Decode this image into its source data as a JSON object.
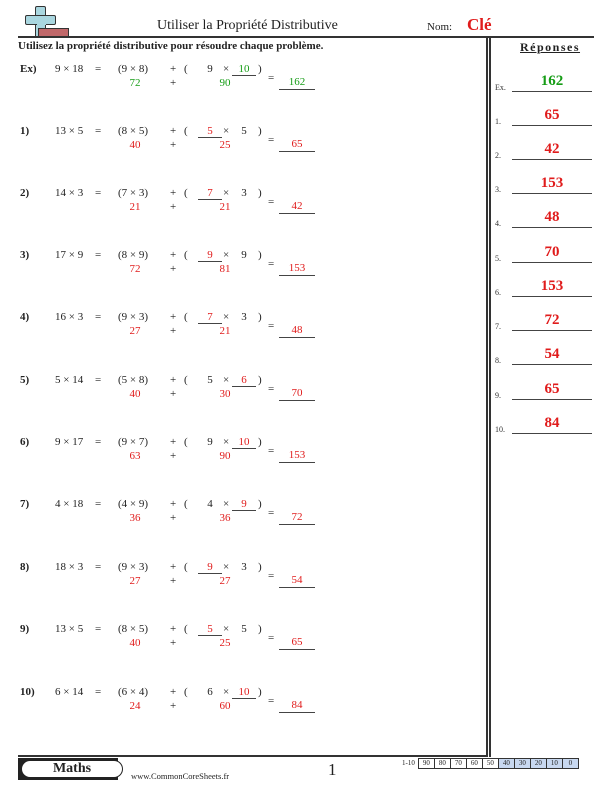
{
  "header": {
    "title": "Utiliser la Propriété Distributive",
    "name_label": "Nom:",
    "name_value": "Clé",
    "instructions": "Utilisez la propriété distributive pour résoudre chaque problème."
  },
  "answers": {
    "title": "Réponses",
    "items": [
      {
        "label": "Ex.",
        "value": "162"
      },
      {
        "label": "1.",
        "value": "65"
      },
      {
        "label": "2.",
        "value": "42"
      },
      {
        "label": "3.",
        "value": "153"
      },
      {
        "label": "4.",
        "value": "48"
      },
      {
        "label": "5.",
        "value": "70"
      },
      {
        "label": "6.",
        "value": "153"
      },
      {
        "label": "7.",
        "value": "72"
      },
      {
        "label": "8.",
        "value": "54"
      },
      {
        "label": "9.",
        "value": "65"
      },
      {
        "label": "10.",
        "value": "84"
      }
    ]
  },
  "problems": [
    {
      "num": "Ex)",
      "expr": "9 × 18",
      "eq": "=",
      "part1": "(9 × 8)",
      "plus": "+",
      "open": "(",
      "a": "9",
      "times": "×",
      "b": "10",
      "close": ")",
      "left": "72",
      "right": "90",
      "eq2": "=",
      "total": "162"
    },
    {
      "num": "1)",
      "expr": "13 × 5",
      "eq": "=",
      "part1": "(8 × 5)",
      "plus": "+",
      "open": "(",
      "a": "5",
      "times": "×",
      "b": "5",
      "close": ")",
      "left": "40",
      "right": "25",
      "eq2": "=",
      "total": "65"
    },
    {
      "num": "2)",
      "expr": "14 × 3",
      "eq": "=",
      "part1": "(7 × 3)",
      "plus": "+",
      "open": "(",
      "a": "7",
      "times": "×",
      "b": "3",
      "close": ")",
      "left": "21",
      "right": "21",
      "eq2": "=",
      "total": "42"
    },
    {
      "num": "3)",
      "expr": "17 × 9",
      "eq": "=",
      "part1": "(8 × 9)",
      "plus": "+",
      "open": "(",
      "a": "9",
      "times": "×",
      "b": "9",
      "close": ")",
      "left": "72",
      "right": "81",
      "eq2": "=",
      "total": "153"
    },
    {
      "num": "4)",
      "expr": "16 × 3",
      "eq": "=",
      "part1": "(9 × 3)",
      "plus": "+",
      "open": "(",
      "a": "7",
      "times": "×",
      "b": "3",
      "close": ")",
      "left": "27",
      "right": "21",
      "eq2": "=",
      "total": "48"
    },
    {
      "num": "5)",
      "expr": "5 × 14",
      "eq": "=",
      "part1": "(5 × 8)",
      "plus": "+",
      "open": "(",
      "a": "5",
      "times": "×",
      "b": "6",
      "close": ")",
      "left": "40",
      "right": "30",
      "eq2": "=",
      "total": "70"
    },
    {
      "num": "6)",
      "expr": "9 × 17",
      "eq": "=",
      "part1": "(9 × 7)",
      "plus": "+",
      "open": "(",
      "a": "9",
      "times": "×",
      "b": "10",
      "close": ")",
      "left": "63",
      "right": "90",
      "eq2": "=",
      "total": "153"
    },
    {
      "num": "7)",
      "expr": "4 × 18",
      "eq": "=",
      "part1": "(4 × 9)",
      "plus": "+",
      "open": "(",
      "a": "4",
      "times": "×",
      "b": "9",
      "close": ")",
      "left": "36",
      "right": "36",
      "eq2": "=",
      "total": "72"
    },
    {
      "num": "8)",
      "expr": "18 × 3",
      "eq": "=",
      "part1": "(9 × 3)",
      "plus": "+",
      "open": "(",
      "a": "9",
      "times": "×",
      "b": "3",
      "close": ")",
      "left": "27",
      "right": "27",
      "eq2": "=",
      "total": "54"
    },
    {
      "num": "9)",
      "expr": "13 × 5",
      "eq": "=",
      "part1": "(8 × 5)",
      "plus": "+",
      "open": "(",
      "a": "5",
      "times": "×",
      "b": "5",
      "close": ")",
      "left": "40",
      "right": "25",
      "eq2": "=",
      "total": "65"
    },
    {
      "num": "10)",
      "expr": "6 × 14",
      "eq": "=",
      "part1": "(6 × 4)",
      "plus": "+",
      "open": "(",
      "a": "6",
      "times": "×",
      "b": "10",
      "close": ")",
      "left": "24",
      "right": "60",
      "eq2": "=",
      "total": "84"
    }
  ],
  "blank_position": [
    "b",
    "a",
    "a",
    "a",
    "a",
    "b",
    "b",
    "b",
    "a",
    "a",
    "b"
  ],
  "footer": {
    "subject": "Maths",
    "url": "www.CommonCoreSheets.fr",
    "page": "1",
    "score_label": "1-10",
    "scores": [
      "90",
      "80",
      "70",
      "60",
      "50",
      "40",
      "30",
      "20",
      "10",
      "0"
    ],
    "highlighted_from_index": 5
  },
  "colors": {
    "answer_red": "#e01b1b",
    "example_green": "#159c15",
    "score_highlight": "#c8d8f0"
  }
}
